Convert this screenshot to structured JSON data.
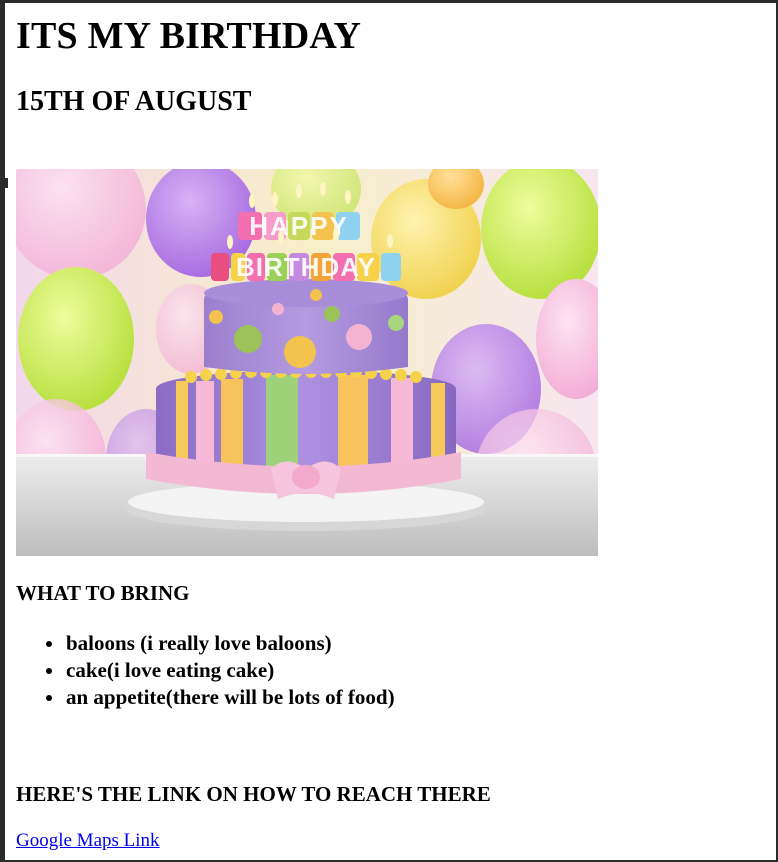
{
  "header": {
    "title": "ITS MY BIRTHDAY",
    "date": "15TH OF AUGUST"
  },
  "image": {
    "name": "birthday-cake-image",
    "cake_topper_line1": "HAPPY",
    "cake_topper_line2": "BIRTHDAY"
  },
  "bring": {
    "heading": "WHAT TO BRING",
    "items": [
      "baloons (i really love baloons)",
      "cake(i love eating cake)",
      "an appetite(there will be lots of food)"
    ]
  },
  "directions": {
    "heading": "HERE'S THE LINK ON HOW TO REACH THERE",
    "link_text": "Google Maps Link"
  },
  "colors": {
    "link": "#0000ee",
    "text": "#000000",
    "background": "#ffffff",
    "frame": "#2b2b2b"
  }
}
